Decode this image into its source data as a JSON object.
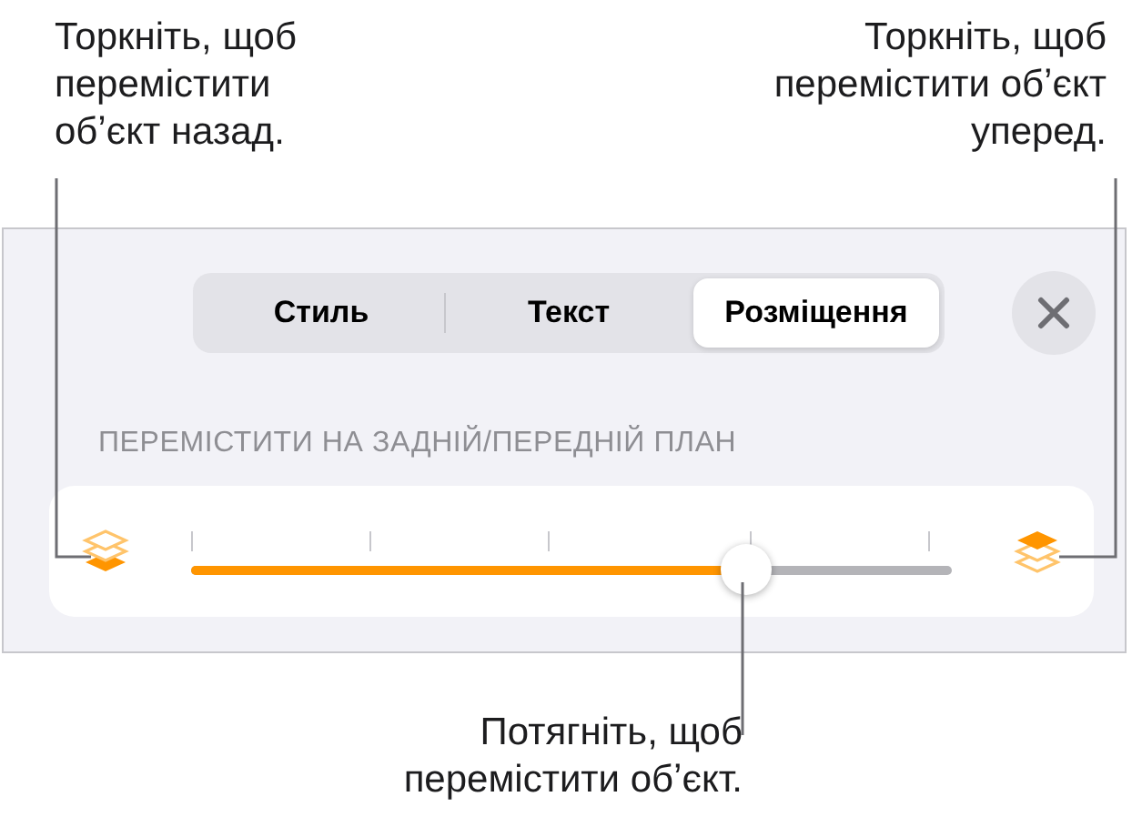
{
  "callouts": [
    {
      "kind": "left",
      "text": "Торкніть, щоб перемістити обʼєкт назад."
    },
    {
      "kind": "right",
      "text": "Торкніть, щоб перемістити обʼєкт уперед."
    },
    {
      "kind": "bottom",
      "text": "Потягніть, щоб перемістити обʼєкт."
    }
  ],
  "tabs": [
    {
      "label": "Стиль",
      "selected": false
    },
    {
      "label": "Текст",
      "selected": false
    },
    {
      "label": "Розміщення",
      "selected": true
    }
  ],
  "section_label": "ПЕРЕМІСТИТИ НА ЗАДНІЙ/ПЕРЕДНІЙ ПЛАН",
  "slider": {
    "level": 0.73
  }
}
